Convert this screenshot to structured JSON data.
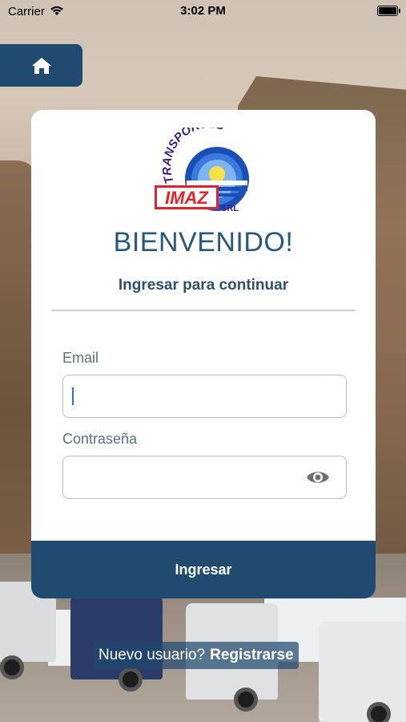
{
  "status_bar": {
    "carrier": "Carrier",
    "time": "3:02 PM",
    "icons": [
      "wifi-icon",
      "battery-icon"
    ]
  },
  "nav": {
    "home_icon": "home-icon"
  },
  "logo": {
    "top_text": "TRANSPORTES",
    "brand_text": "IMAZ",
    "suffix_text": "SRL"
  },
  "login": {
    "welcome": "BIENVENIDO!",
    "subtitle": "Ingresar para continuar",
    "email_label": "Email",
    "email_value": "",
    "password_label": "Contraseña",
    "password_value": "",
    "password_toggle_icon": "eye-icon",
    "submit_label": "Ingresar"
  },
  "register": {
    "prompt": "Nuevo usuario?",
    "link_label": "Registrarse"
  },
  "colors": {
    "primary": "#204a6f",
    "title": "#2a587c",
    "label": "#5a7086",
    "logo_red": "#e3222b",
    "logo_blue": "#1a4fb7",
    "logo_purple": "#3a1f8a"
  }
}
